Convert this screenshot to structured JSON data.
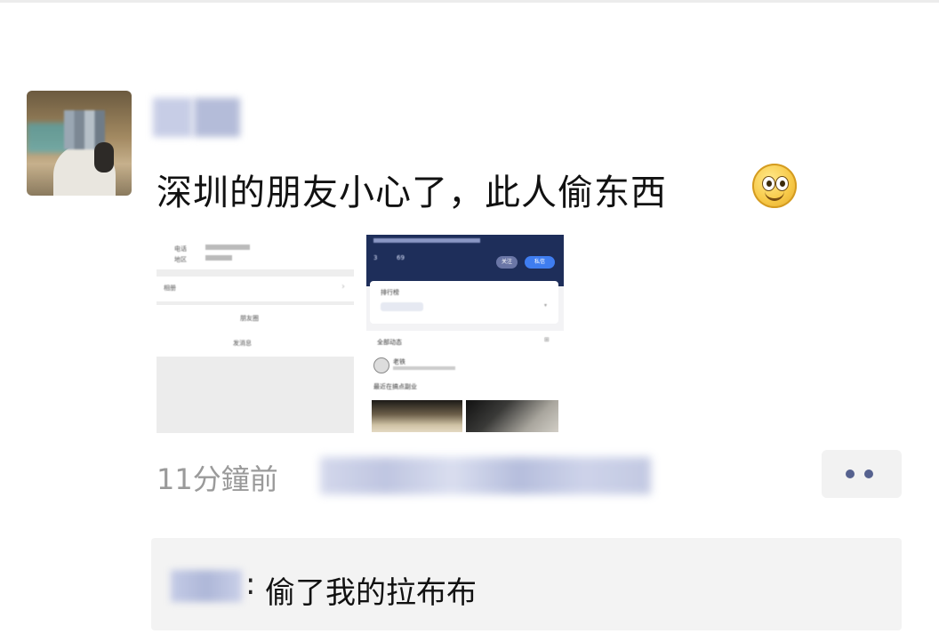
{
  "post": {
    "text": "深圳的朋友小心了，此人偷东西",
    "emoji_icon": "smiley-icon",
    "time": "11分鐘前"
  },
  "shot1": {
    "line_a": "电话",
    "line_b": "地区",
    "row1": "相册",
    "row2": "朋友圈",
    "row3": "发消息"
  },
  "shot2": {
    "header_right": "关注",
    "follow_label": "私信",
    "card_title": "排行榜",
    "section_title": "全部动态",
    "user_name": "老铁",
    "post_line": "最近在搞点副业"
  },
  "comment": {
    "separator": ":",
    "text": "偷了我的拉布布"
  },
  "colors": {
    "meta_gray": "#9a9a9a",
    "dot_blue": "#56628f",
    "comment_bg": "#f3f3f3"
  }
}
